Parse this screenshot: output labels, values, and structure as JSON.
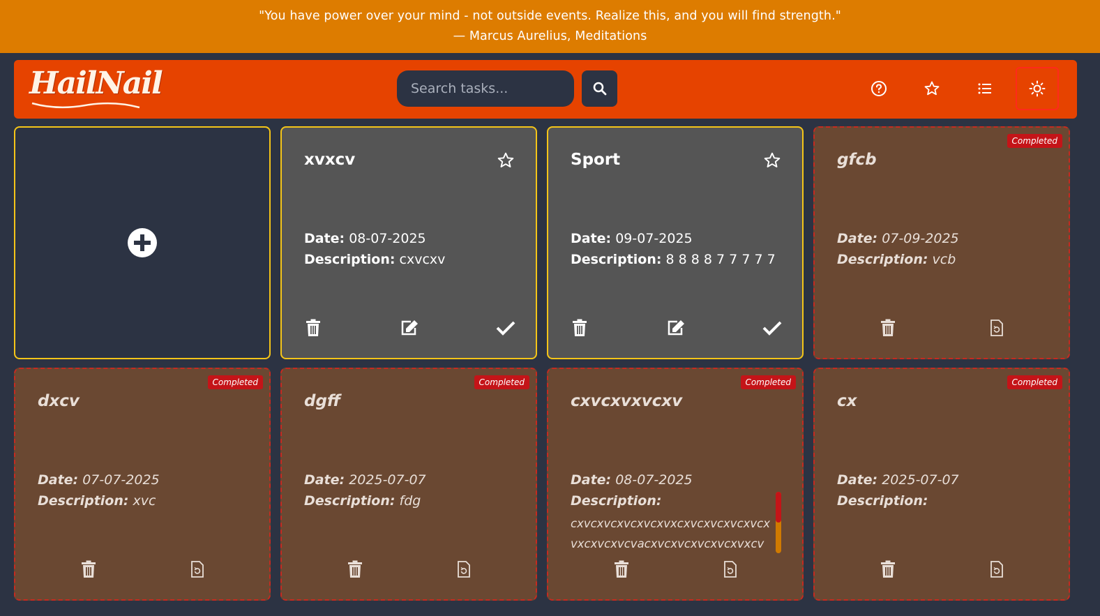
{
  "quote": {
    "text": "\"You have power over your mind - not outside events. Realize this, and you will find strength.\"",
    "author": "— Marcus Aurelius, Meditations"
  },
  "header": {
    "logo": "HailNail",
    "search_placeholder": "Search tasks...",
    "icons": [
      "search-icon",
      "help-icon",
      "star-icon",
      "list-icon",
      "sun-icon"
    ]
  },
  "labels": {
    "date": "Date:",
    "description": "Description:",
    "completed": "Completed"
  },
  "active_tasks": [
    {
      "title": "xvxcv",
      "date": "08-07-2025",
      "description": "cxvcxv"
    },
    {
      "title": "Sport",
      "date": "09-07-2025",
      "description": "8 8 8 8 7 7 7 7 7"
    }
  ],
  "completed_tasks": [
    {
      "title": "gfcb",
      "date": "07-09-2025",
      "description": "vcb"
    },
    {
      "title": "dxcv",
      "date": "07-07-2025",
      "description": "xvc"
    },
    {
      "title": "dgff",
      "date": "2025-07-07",
      "description": "fdg"
    },
    {
      "title": "cxvcxvxvcxv",
      "date": "08-07-2025",
      "description": "cxvcxvcxvcxvcxvxcxvcxvcxvcxvcxvxcxvcxvcvacxvcxvcxvcxvcxvxcv"
    },
    {
      "title": "cx",
      "date": "2025-07-07",
      "description": ""
    }
  ],
  "colors": {
    "quote_bar": "#dd7c00",
    "header": "#e64300",
    "background": "#2c3343",
    "active_card": "#555555",
    "completed_card": "#6a4832",
    "badge": "#c41418",
    "active_border": "#f5c518"
  }
}
